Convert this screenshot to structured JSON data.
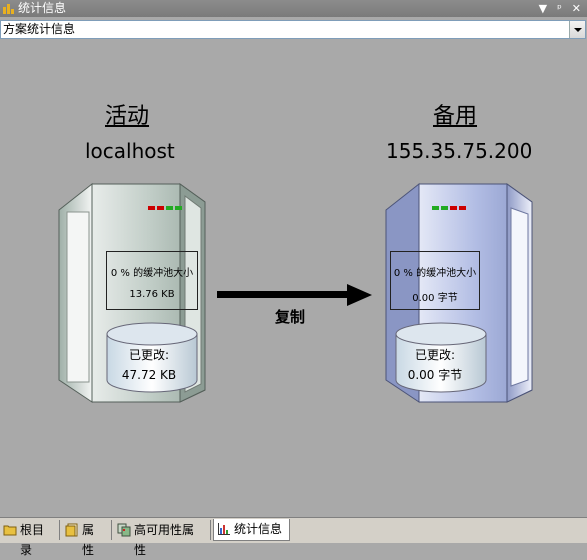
{
  "window": {
    "title": "统计信息",
    "buttons": [
      "▼",
      "ᵖ",
      "✕"
    ]
  },
  "selector": {
    "value": "方案统计信息"
  },
  "primary": {
    "role": "活动",
    "host": "localhost",
    "buffer_label": "0 % 的缓冲池大小",
    "buffer_value": "13.76 KB",
    "changed_label": "已更改:",
    "changed_value": "47.72 KB",
    "lights": [
      "#cc0000",
      "#cc0000",
      "#22aa22",
      "#22aa22"
    ]
  },
  "standby": {
    "role": "备用",
    "host": "155.35.75.200",
    "buffer_label": "0 % 的缓冲池大小",
    "buffer_value": "0.00 字节",
    "changed_label": "已更改:",
    "changed_value": "0.00 字节",
    "lights": [
      "#22aa22",
      "#22aa22",
      "#cc0000",
      "#cc0000"
    ]
  },
  "replication": {
    "label": "复制"
  },
  "tabs": [
    {
      "label": "根目录",
      "icon": "folder-icon"
    },
    {
      "label": "属性",
      "icon": "properties-icon"
    },
    {
      "label": "高可用性属性",
      "icon": "ha-properties-icon"
    },
    {
      "label": "统计信息",
      "icon": "chart-icon",
      "active": true
    }
  ],
  "colors": {
    "primary_server": "#b8c6c0",
    "standby_server": "#a9b4d8",
    "background": "#a9a9a9"
  }
}
